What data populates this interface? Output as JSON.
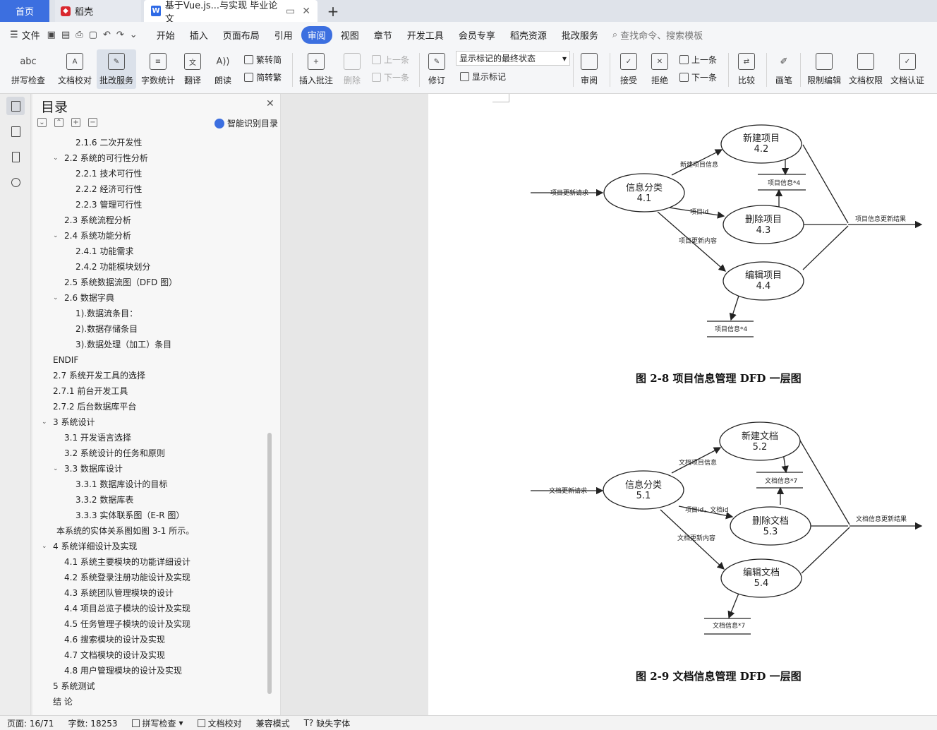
{
  "tabs": {
    "home": "首页",
    "daoke": "稻壳",
    "doc": "基于Vue.js...与实现 毕业论文"
  },
  "menu": {
    "file": "文件",
    "items": [
      "开始",
      "插入",
      "页面布局",
      "引用",
      "审阅",
      "视图",
      "章节",
      "开发工具",
      "会员专享",
      "稻壳资源",
      "批改服务"
    ],
    "active": "审阅",
    "search_placeholder": "查找命令、搜索模板"
  },
  "ribbon": {
    "spell": "拼写检查",
    "proof": "文档校对",
    "correct": "批改服务",
    "wordcount": "字数统计",
    "translate": "翻译",
    "read": "朗读",
    "trad": "繁转简",
    "simp": "简转繁",
    "insert_comment": "插入批注",
    "delete": "删除",
    "prev": "上一条",
    "next": "下一条",
    "revise": "修订",
    "markup_state": "显示标记的最终状态",
    "show_markup": "显示标记",
    "review": "审阅",
    "accept": "接受",
    "reject": "拒绝",
    "prev2": "上一条",
    "next2": "下一条",
    "compare": "比较",
    "pen": "画笔",
    "restrict": "限制编辑",
    "rights": "文档权限",
    "cert": "文档认证"
  },
  "toc": {
    "title": "目录",
    "smart": "智能识别目录",
    "items": [
      {
        "text": "2.1.6  二次开发性",
        "level": 3,
        "caret": false
      },
      {
        "text": "2.2  系统的可行性分析",
        "level": 2,
        "caret": true
      },
      {
        "text": "2.2.1  技术可行性",
        "level": 3,
        "caret": false
      },
      {
        "text": "2.2.2  经济可行性",
        "level": 3,
        "caret": false
      },
      {
        "text": "2.2.3  管理可行性",
        "level": 3,
        "caret": false
      },
      {
        "text": "2.3  系统流程分析",
        "level": 2,
        "caret": false
      },
      {
        "text": "2.4  系统功能分析",
        "level": 2,
        "caret": true
      },
      {
        "text": "2.4.1  功能需求",
        "level": 3,
        "caret": false
      },
      {
        "text": "2.4.2  功能模块划分",
        "level": 3,
        "caret": false
      },
      {
        "text": "2.5  系统数据流图（DFD 图）",
        "level": 2,
        "caret": false
      },
      {
        "text": "2.6 数据字典",
        "level": 2,
        "caret": true
      },
      {
        "text": "1).数据流条目：",
        "level": 3,
        "caret": false
      },
      {
        "text": "2).数据存储条目",
        "level": 3,
        "caret": false
      },
      {
        "text": "3).数据处理（加工）条目",
        "level": 3,
        "caret": false
      },
      {
        "text": "ENDIF",
        "level": 1,
        "caret": false
      },
      {
        "text": "2.7  系统开发工具的选择",
        "level": 1,
        "caret": false
      },
      {
        "text": "2.7.1  前台开发工具",
        "level": 1,
        "caret": false
      },
      {
        "text": "2.7.2  后台数据库平台",
        "level": 1,
        "caret": false
      },
      {
        "text": "3  系统设计",
        "level": 1,
        "caret": true
      },
      {
        "text": "3.1  开发语言选择",
        "level": 2,
        "caret": false
      },
      {
        "text": "3.2  系统设计的任务和原则",
        "level": 2,
        "caret": false
      },
      {
        "text": "3.3  数据库设计",
        "level": 2,
        "caret": true
      },
      {
        "text": "3.3.1  数据库设计的目标",
        "level": 3,
        "caret": false
      },
      {
        "text": "3.3.2  数据库表",
        "level": 3,
        "caret": false
      },
      {
        "text": "3.3.3  实体联系图（E-R 图）",
        "level": 3,
        "caret": false
      },
      {
        "text": "本系统的实体关系图如图 3-1 所示。",
        "level": 0,
        "caret": false
      },
      {
        "text": "4  系统详细设计及实现",
        "level": 1,
        "caret": true
      },
      {
        "text": "4.1 系统主要模块的功能详细设计",
        "level": 2,
        "caret": false
      },
      {
        "text": "4.2  系统登录注册功能设计及实现",
        "level": 2,
        "caret": false
      },
      {
        "text": "4.3  系统团队管理模块的设计",
        "level": 2,
        "caret": false
      },
      {
        "text": "4.4  项目总览子模块的设计及实现",
        "level": 2,
        "caret": false
      },
      {
        "text": "4.5  任务管理子模块的设计及实现",
        "level": 2,
        "caret": false
      },
      {
        "text": "4.6  搜索模块的设计及实现",
        "level": 2,
        "caret": false
      },
      {
        "text": "4.7  文档模块的设计及实现",
        "level": 2,
        "caret": false
      },
      {
        "text": "4.8  用户管理模块的设计及实现",
        "level": 2,
        "caret": false
      },
      {
        "text": "5  系统测试",
        "level": 1,
        "caret": false
      },
      {
        "text": "结    论",
        "level": 1,
        "caret": false
      }
    ]
  },
  "figure1": {
    "caption": "图 2-8    项目信息管理 DFD 一层图",
    "input": "项目更新请求",
    "classify": "信息分类",
    "classify_id": "4.1",
    "new": "新建项目",
    "new_id": "4.2",
    "del": "删除项目",
    "del_id": "4.3",
    "edit": "编辑项目",
    "edit_id": "4.4",
    "flow_new": "新建项目信息",
    "flow_del": "项目id",
    "flow_edit": "项目更新内容",
    "store_a": "项目信息*4",
    "store_b": "项目信息*4",
    "output": "项目信息更新结果"
  },
  "figure2": {
    "caption": "图 2-9    文档信息管理 DFD 一层图",
    "input": "文档更新请求",
    "classify": "信息分类",
    "classify_id": "5.1",
    "new": "新建文档",
    "new_id": "5.2",
    "del": "删除文档",
    "del_id": "5.3",
    "edit": "编辑文档",
    "edit_id": "5.4",
    "flow_new": "文档项目信息",
    "flow_del": "项目id，文档id",
    "flow_edit": "文档更新内容",
    "store_a": "文档信息*7",
    "store_b": "文档信息*7",
    "output": "文档信息更新结果"
  },
  "status": {
    "page": "页面: 16/71",
    "words": "字数: 18253",
    "spell": "拼写检查",
    "proof": "文档校对",
    "compat": "兼容模式",
    "missing_font": "缺失字体"
  }
}
